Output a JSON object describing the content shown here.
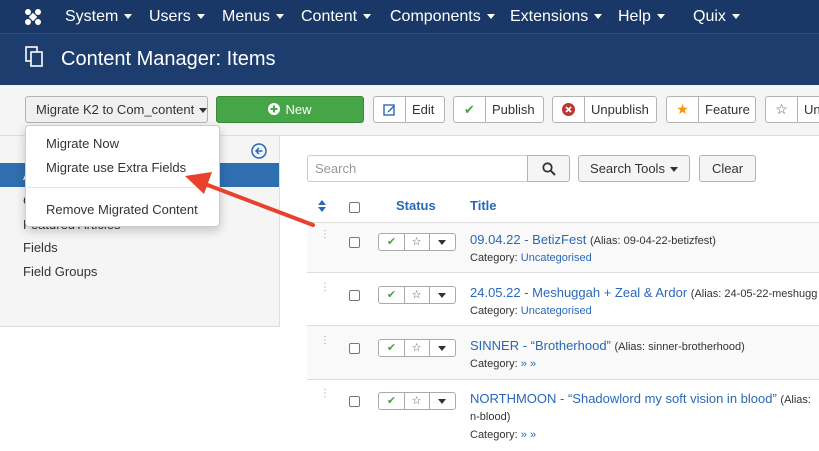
{
  "topnav": {
    "items": [
      "System",
      "Users",
      "Menus",
      "Content",
      "Components",
      "Extensions",
      "Help",
      "Quix"
    ]
  },
  "header": {
    "title": "Content Manager: Items"
  },
  "toolbar": {
    "migrate_label": "Migrate K2 to Com_content",
    "new_label": "New",
    "edit_label": "Edit",
    "publish_label": "Publish",
    "unpublish_label": "Unpublish",
    "feature_label": "Feature",
    "unfeature_label": "Un"
  },
  "dropdown": {
    "items": [
      "Migrate Now",
      "Migrate use Extra Fields",
      "Remove Migrated Content"
    ]
  },
  "sidebar": {
    "items": [
      "A",
      "C",
      "Featured Articles",
      "Fields",
      "Field Groups"
    ]
  },
  "search": {
    "placeholder": "Search",
    "tools_label": "Search Tools",
    "clear_label": "Clear"
  },
  "table": {
    "headers": {
      "status": "Status",
      "title": "Title"
    },
    "rows": [
      {
        "title": "09.04.22 - BetizFest",
        "alias": "(Alias: 09-04-22-betizfest)",
        "category_label": "Category:",
        "category": "Uncategorised"
      },
      {
        "title": "24.05.22 - Meshuggah + Zeal & Ardor",
        "alias": "(Alias: 24-05-22-meshugg",
        "category_label": "Category:",
        "category": "Uncategorised"
      },
      {
        "title": "SINNER - “Brotherhood”",
        "alias": "(Alias: sinner-brotherhood)",
        "category_label": "Category:",
        "category": "» »"
      },
      {
        "title": "NORTHMOON - “Shadowlord my soft vision in blood”",
        "alias": "(Alias:",
        "alias_cont": "n-blood)",
        "category_label": "Category:",
        "category": "» »"
      }
    ]
  },
  "colors": {
    "nav": "#1a3867",
    "header": "#1c3d6e",
    "new_button": "#46a546",
    "link": "#2a69b8",
    "arrow": "#e8412c"
  }
}
